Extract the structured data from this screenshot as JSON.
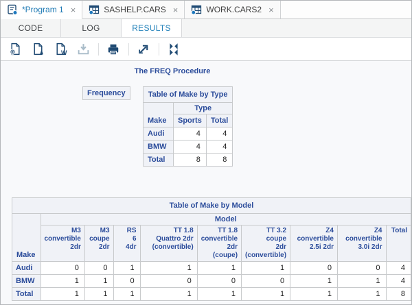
{
  "tabs": [
    {
      "label": "*Program 1",
      "icon": "program-icon",
      "close": "×",
      "active": true
    },
    {
      "label": "SASHELP.CARS",
      "icon": "table-icon",
      "close": "×",
      "active": false
    },
    {
      "label": "WORK.CARS2",
      "icon": "table-icon",
      "close": "×",
      "active": false
    }
  ],
  "subtabs": [
    {
      "label": "CODE",
      "active": false
    },
    {
      "label": "LOG",
      "active": false
    },
    {
      "label": "RESULTS",
      "active": true
    }
  ],
  "toolbar": {
    "icons": [
      "download-html-icon",
      "download-pdf-icon",
      "download-rtf-icon",
      "download-icon",
      "print-icon",
      "open-new-window-icon",
      "collapse-icon"
    ]
  },
  "results": {
    "proc_title": "The FREQ Procedure",
    "freq_label": "Frequency",
    "table1": {
      "title": "Table of Make by Type",
      "row_var": "Make",
      "col_var": "Type",
      "columns": [
        "Sports",
        "Total"
      ],
      "rows": [
        {
          "label": "Audi",
          "values": [
            4,
            4
          ]
        },
        {
          "label": "BMW",
          "values": [
            4,
            4
          ]
        },
        {
          "label": "Total",
          "values": [
            8,
            8
          ]
        }
      ]
    },
    "table2": {
      "title": "Table of Make by Model",
      "row_var": "Make",
      "col_var": "Model",
      "columns": [
        "M3\nconvertible\n2dr",
        "M3\ncoupe\n2dr",
        "RS\n6\n4dr",
        "TT 1.8\nQuattro 2dr\n(convertible)",
        "TT 1.8\nconvertible\n2dr\n(coupe)",
        "TT 3.2 coupe\n2dr\n(convertible)",
        "Z4\nconvertible\n2.5i 2dr",
        "Z4\nconvertible\n3.0i 2dr",
        "Total"
      ],
      "rows": [
        {
          "label": "Audi",
          "values": [
            0,
            0,
            1,
            1,
            1,
            1,
            0,
            0,
            4
          ]
        },
        {
          "label": "BMW",
          "values": [
            1,
            1,
            0,
            0,
            0,
            0,
            1,
            1,
            4
          ]
        },
        {
          "label": "Total",
          "values": [
            1,
            1,
            1,
            1,
            1,
            1,
            1,
            1,
            8
          ]
        }
      ]
    }
  },
  "colors": {
    "header_text": "#2b4c9b",
    "header_bg": "#f0f2f7",
    "table_border": "#c8cacc",
    "active_tab_text": "#1d79b4",
    "results_tab_text": "#2482ba",
    "icon_navy": "#1f4a73",
    "icon_blue_dot": "#1d78be",
    "disabled_icon": "#a9bcc9",
    "panel_bg": "#f8f9fb"
  }
}
